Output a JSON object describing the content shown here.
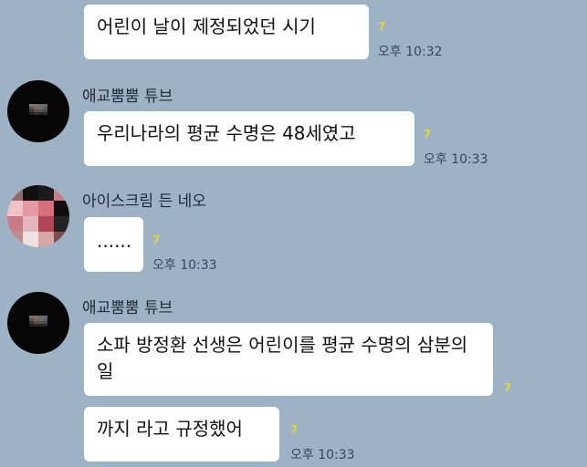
{
  "chat": {
    "messages": [
      {
        "text": "어린이 날이 제정되었던 시기",
        "unread": "7",
        "time": "오후 10:32"
      },
      {
        "sender": "애교뿜뿜 튜브",
        "text": "우리나라의 평균 수명은 48세였고",
        "unread": "7",
        "time": "오후 10:33"
      },
      {
        "sender": "아이스크림 든 네오",
        "text": "......",
        "unread": "7",
        "time": "오후 10:33"
      },
      {
        "sender": "애교뿜뿜 튜브",
        "text": "소파 방정환 선생은 어린이를 평균 수명의 삼분의 일",
        "unread": "7"
      },
      {
        "text": "까지 라고 규정했어",
        "unread": "7",
        "time": "오후 10:33"
      }
    ]
  },
  "colors": {
    "background": "#9eb2c6",
    "bubble": "#ffffff",
    "unread": "#e3d32f",
    "time": "#34495c"
  }
}
